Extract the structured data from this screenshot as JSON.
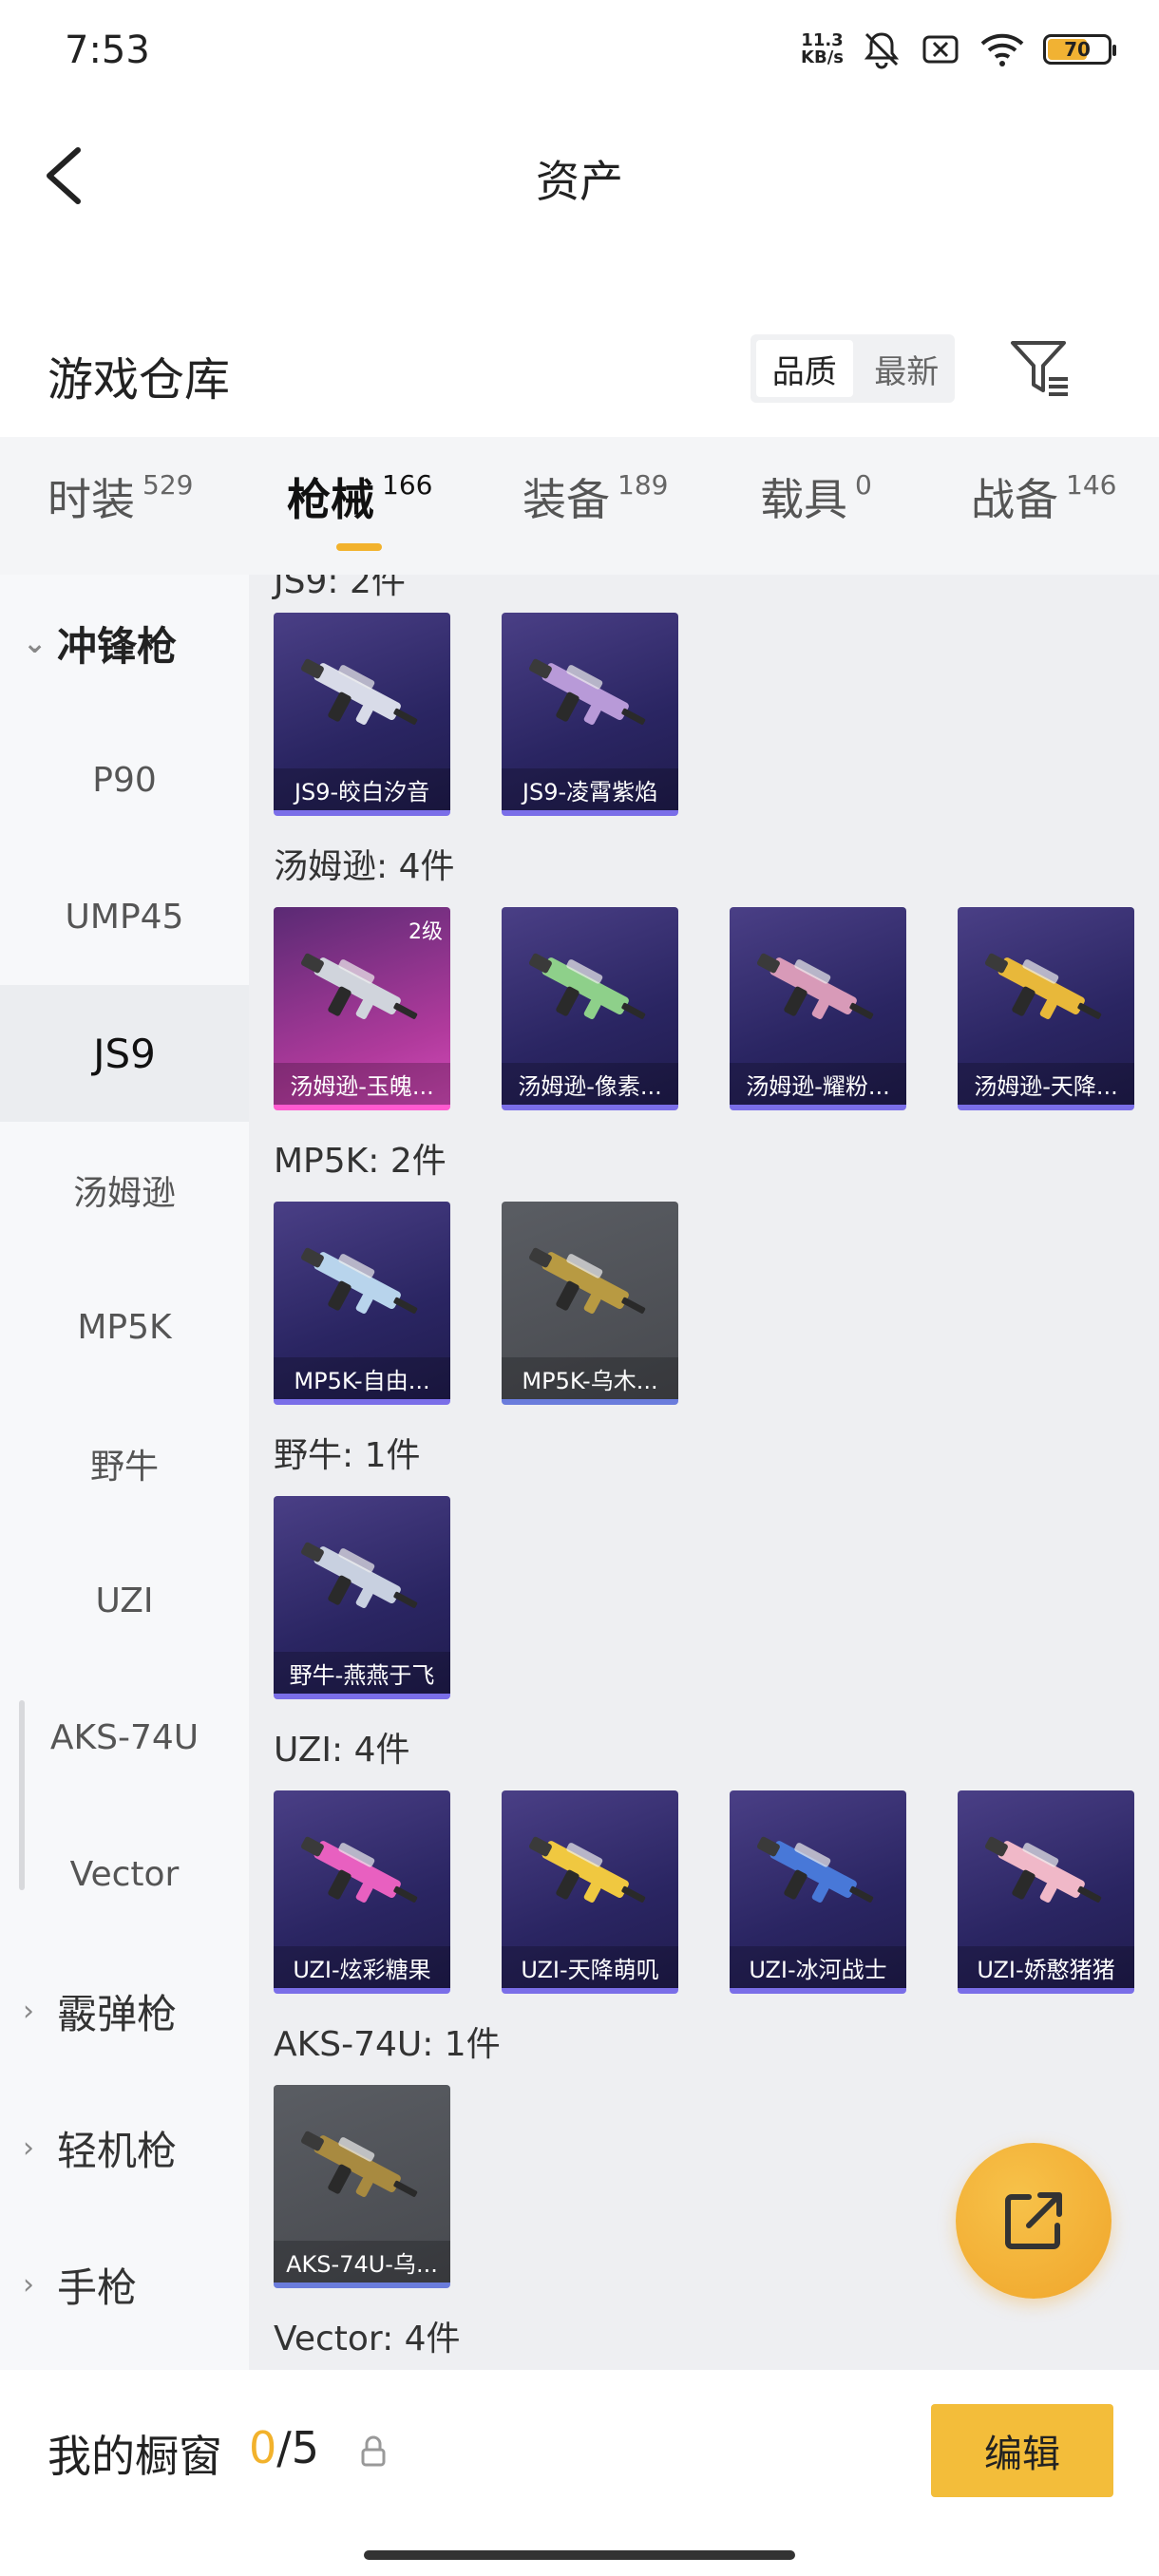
{
  "status_bar": {
    "time": "7:53",
    "net_speed_value": "11.3",
    "net_speed_unit": "KB/s",
    "battery_level": "70",
    "icons": [
      "mute-icon",
      "sim-off-icon",
      "wifi-icon",
      "battery-icon"
    ]
  },
  "header": {
    "title": "资产",
    "back_icon": "chevron-left-icon"
  },
  "warehouse": {
    "title": "游戏仓库",
    "sort_options": [
      "品质",
      "最新"
    ],
    "sort_selected": "品质",
    "filter_icon": "filter-icon"
  },
  "tabs": [
    {
      "label": "时装",
      "count": "529"
    },
    {
      "label": "枪械",
      "count": "166"
    },
    {
      "label": "装备",
      "count": "189"
    },
    {
      "label": "载具",
      "count": "0"
    },
    {
      "label": "战备",
      "count": "146"
    }
  ],
  "active_tab": "枪械",
  "sidebar": {
    "group_open": "冲锋枪",
    "items": [
      "P90",
      "UMP45",
      "JS9",
      "汤姆逊",
      "MP5K",
      "野牛",
      "UZI",
      "AKS-74U",
      "Vector"
    ],
    "selected": "JS9",
    "groups_closed": [
      "霰弹枪",
      "轻机枪",
      "手枪"
    ]
  },
  "sections": [
    {
      "title": "JS9: 2件",
      "items": [
        {
          "label": "JS9-皎白汐音",
          "color": "#d8dbe8"
        },
        {
          "label": "JS9-凌霄紫焰",
          "color": "#b89ad8"
        }
      ]
    },
    {
      "title": "汤姆逊: 4件",
      "items": [
        {
          "label": "汤姆逊-玉魄...",
          "color": "#d0d4dc",
          "level": "2级"
        },
        {
          "label": "汤姆逊-像素...",
          "color": "#8ed08a"
        },
        {
          "label": "汤姆逊-耀粉...",
          "color": "#d89ab8"
        },
        {
          "label": "汤姆逊-天降...",
          "color": "#e8b83a"
        }
      ]
    },
    {
      "title": "MP5K: 2件",
      "items": [
        {
          "label": "MP5K-自由...",
          "color": "#b8d4ec"
        },
        {
          "label": "MP5K-乌木...",
          "color": "#b89a42"
        }
      ]
    },
    {
      "title": "野牛: 1件",
      "items": [
        {
          "label": "野牛-燕燕于飞",
          "color": "#c8d0e0"
        }
      ]
    },
    {
      "title": "UZI: 4件",
      "items": [
        {
          "label": "UZI-炫彩糖果",
          "color": "#e860c0"
        },
        {
          "label": "UZI-天降萌叽",
          "color": "#f0c840"
        },
        {
          "label": "UZI-冰河战士",
          "color": "#4878d8"
        },
        {
          "label": "UZI-娇憨猪猪",
          "color": "#f0b8c8"
        }
      ]
    },
    {
      "title": "AKS-74U: 1件",
      "items": [
        {
          "label": "AKS-74U-乌...",
          "color": "#a88a40"
        }
      ]
    },
    {
      "title": "Vector: 4件",
      "items": []
    }
  ],
  "partial_section_title": "JS9: 2件",
  "bottom_bar": {
    "label": "我的橱窗",
    "current": "0",
    "separator": "/",
    "total": "5",
    "edit_label": "编辑"
  },
  "fab_icon": "share-icon"
}
